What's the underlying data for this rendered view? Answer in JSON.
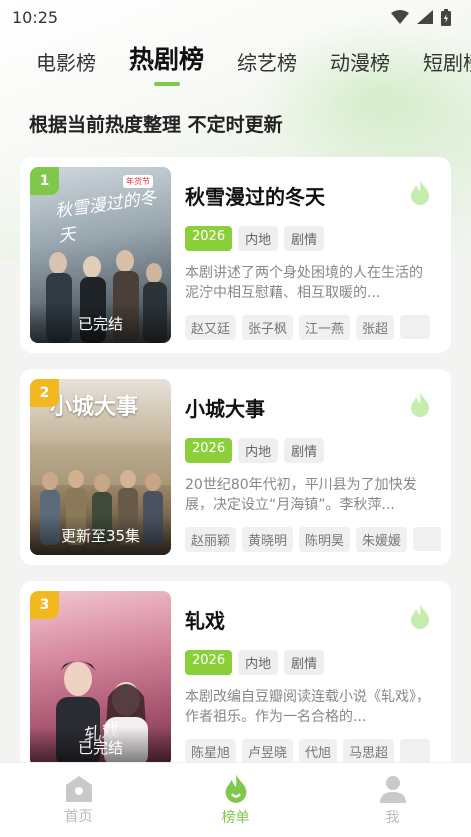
{
  "status_bar": {
    "time": "10:25"
  },
  "tabs": [
    {
      "label": "电影榜",
      "active": false
    },
    {
      "label": "热剧榜",
      "active": true
    },
    {
      "label": "综艺榜",
      "active": false
    },
    {
      "label": "动漫榜",
      "active": false
    },
    {
      "label": "短剧榜",
      "active": false
    }
  ],
  "subtitle": "根据当前热度整理 不定时更新",
  "items": [
    {
      "rank": "1",
      "title": "秋雪漫过的冬天",
      "status": "已完结",
      "year": "2026",
      "region": "内地",
      "genre": "剧情",
      "desc": "本剧讲述了两个身处困境的人在生活的泥泞中相互慰藉、相互取暖的...",
      "cast": [
        "赵又廷",
        "张子枫",
        "江一燕",
        "张超"
      ],
      "poster_art": "秋雪漫过的冬天",
      "poster_sticker": "年货节"
    },
    {
      "rank": "2",
      "title": "小城大事",
      "status": "更新至35集",
      "year": "2026",
      "region": "内地",
      "genre": "剧情",
      "desc": "20世纪80年代初，平川县为了加快发展，决定设立“月海镇”。李秋萍...",
      "cast": [
        "赵丽颖",
        "黄晓明",
        "陈明昊",
        "朱媛媛"
      ],
      "poster_art": "小城大事"
    },
    {
      "rank": "3",
      "title": "轧戏",
      "status": "已完结",
      "year": "2026",
      "region": "内地",
      "genre": "剧情",
      "desc": "本剧改编自豆瓣阅读连载小说《轧戏》，作者祖乐。作为一名合格的...",
      "cast": [
        "陈星旭",
        "卢昱晓",
        "代旭",
        "马思超"
      ],
      "poster_art": "轧戏"
    }
  ],
  "bottom_nav": [
    {
      "label": "首页",
      "icon": "home-icon",
      "active": false
    },
    {
      "label": "榜单",
      "icon": "flame-icon",
      "active": true
    },
    {
      "label": "我",
      "icon": "person-icon",
      "active": false
    }
  ],
  "colors": {
    "accent": "#7fc84a",
    "rank_gold": "#f3b81f",
    "year_tag": "#8bcf3a"
  }
}
